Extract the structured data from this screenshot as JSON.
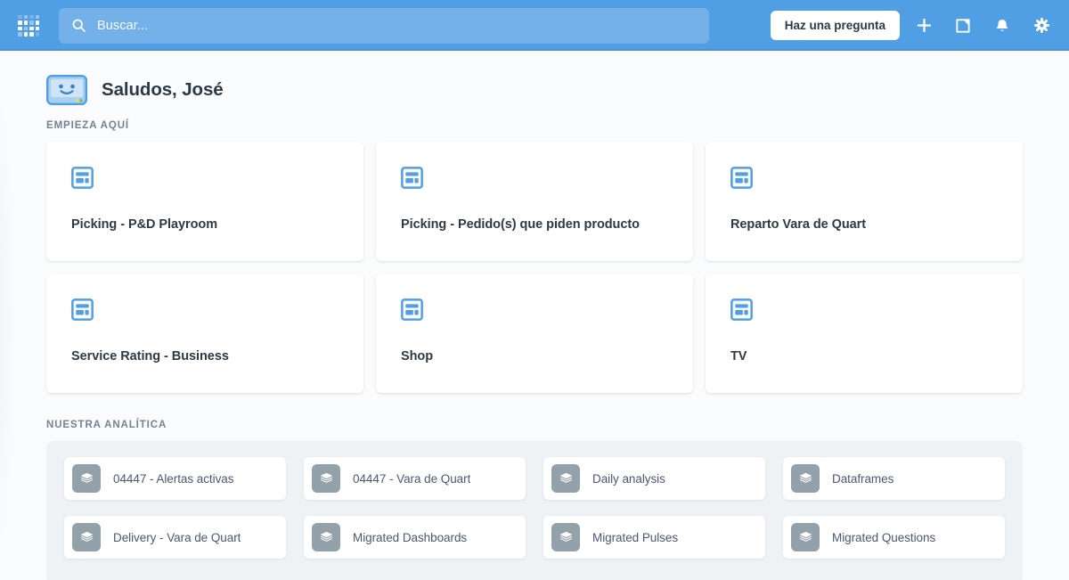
{
  "app": {
    "brand_color": "#509EE3",
    "page_bg": "#F9FBFC",
    "panel_bg": "#EEF2F5",
    "text_color": "#2D3A45",
    "muted_text_color": "#74838F",
    "collection_icon_color": "#93A1AB"
  },
  "navbar": {
    "logo_name": "metabase-logo",
    "search": {
      "placeholder": "Buscar...",
      "value": "",
      "icon": "search-icon"
    },
    "ask_button_label": "Haz una pregunta",
    "icons": [
      {
        "name": "plus-icon",
        "title": "Nuevo"
      },
      {
        "name": "new-dashboard-icon",
        "title": "Dashboard"
      },
      {
        "name": "bell-icon",
        "title": "Notificaciones"
      },
      {
        "name": "gear-icon",
        "title": "Configuración"
      }
    ]
  },
  "greeting": {
    "avatar_icon": "metabot-smiley-icon",
    "text": "Saludos, José"
  },
  "sections": {
    "start_here": {
      "label": "EMPIEZA AQUÍ",
      "cards": [
        {
          "icon": "dashboard-icon",
          "title": "Picking - P&D Playroom"
        },
        {
          "icon": "dashboard-icon",
          "title": "Picking - Pedido(s) que piden producto"
        },
        {
          "icon": "dashboard-icon",
          "title": "Reparto Vara de Quart"
        },
        {
          "icon": "dashboard-icon",
          "title": "Service Rating - Business"
        },
        {
          "icon": "dashboard-icon",
          "title": "Shop"
        },
        {
          "icon": "dashboard-icon",
          "title": "TV"
        }
      ]
    },
    "our_analytics": {
      "label": "NUESTRA ANALÍTICA",
      "collections": [
        {
          "icon": "collection-stack-icon",
          "name": "04447 - Alertas activas"
        },
        {
          "icon": "collection-stack-icon",
          "name": "04447 - Vara de Quart"
        },
        {
          "icon": "collection-stack-icon",
          "name": "Daily analysis"
        },
        {
          "icon": "collection-stack-icon",
          "name": "Dataframes"
        },
        {
          "icon": "collection-stack-icon",
          "name": "Delivery - Vara de Quart"
        },
        {
          "icon": "collection-stack-icon",
          "name": "Migrated Dashboards"
        },
        {
          "icon": "collection-stack-icon",
          "name": "Migrated Pulses"
        },
        {
          "icon": "collection-stack-icon",
          "name": "Migrated Questions"
        }
      ]
    }
  }
}
